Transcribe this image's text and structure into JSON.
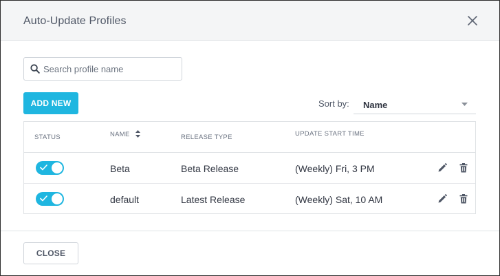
{
  "dialog": {
    "title": "Auto-Update Profiles",
    "close_icon": "close-icon"
  },
  "search": {
    "placeholder": "Search profile name",
    "value": "",
    "icon": "search-icon"
  },
  "toolbar": {
    "add_label": "ADD NEW",
    "sort_label": "Sort by:",
    "sort_value": "Name"
  },
  "table": {
    "headers": {
      "status": "STATUS",
      "name": "NAME",
      "release_type": "RELEASE TYPE",
      "update_start": "UPDATE START TIME"
    },
    "rows": [
      {
        "enabled": true,
        "name": "Beta",
        "release_type": "Beta Release",
        "update_start": "(Weekly) Fri, 3 PM"
      },
      {
        "enabled": true,
        "name": "default",
        "release_type": "Latest Release",
        "update_start": "(Weekly) Sat, 10 AM"
      }
    ]
  },
  "footer": {
    "close_label": "CLOSE"
  },
  "colors": {
    "accent": "#1fb6e0",
    "header_bg": "#f4f5f6",
    "border": "#dfe2e5"
  }
}
